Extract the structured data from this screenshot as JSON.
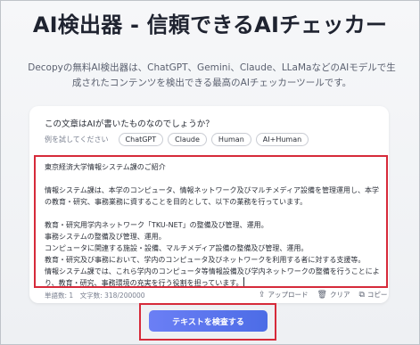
{
  "hero": {
    "title": "AI検出器 - 信頼できるAIチェッカー",
    "description": "Decopyの無料AI検出器は、ChatGPT、Gemini、Claude、LLaMaなどのAIモデルで生成されたコンテンツを検出できる最高のAIチェッカーツールです。"
  },
  "card": {
    "question": "この文章はAIが書いたものなのでしょうか？",
    "examples_label": "例を試してください",
    "examples": [
      "ChatGPT",
      "Claude",
      "Human",
      "AI+Human"
    ],
    "text": "東京経済大学情報システム課のご紹介\n\n情報システム課は、本学のコンピュータ、情報ネットワーク及びマルチメディア設備を管理運用し、本学の教育・研究、事務業務に資することを目的として、以下の業務を行っています。\n\n教育・研究用学内ネットワーク「TKU-NET」の整備及び管理、運用。\n事務システムの整備及び管理、運用。\nコンピュータに関連する施設・設備、マルチメディア設備の整備及び管理、運用。\n教育・研究及び事務において、学内のコンピュータ及びネットワークを利用する者に対する支援等。\n情報システム課では、これら学内のコンピュータ等情報設備及び学内ネットワークの整備を行うことにより、教育・研究、事務環境の充実を行う役割を担っています。",
    "stats": "単語数: 1　文字数: 318/200000",
    "tools": {
      "upload": "アップロード",
      "clear": "クリア",
      "copy": "コピー"
    },
    "submit": "テキストを検査する"
  }
}
